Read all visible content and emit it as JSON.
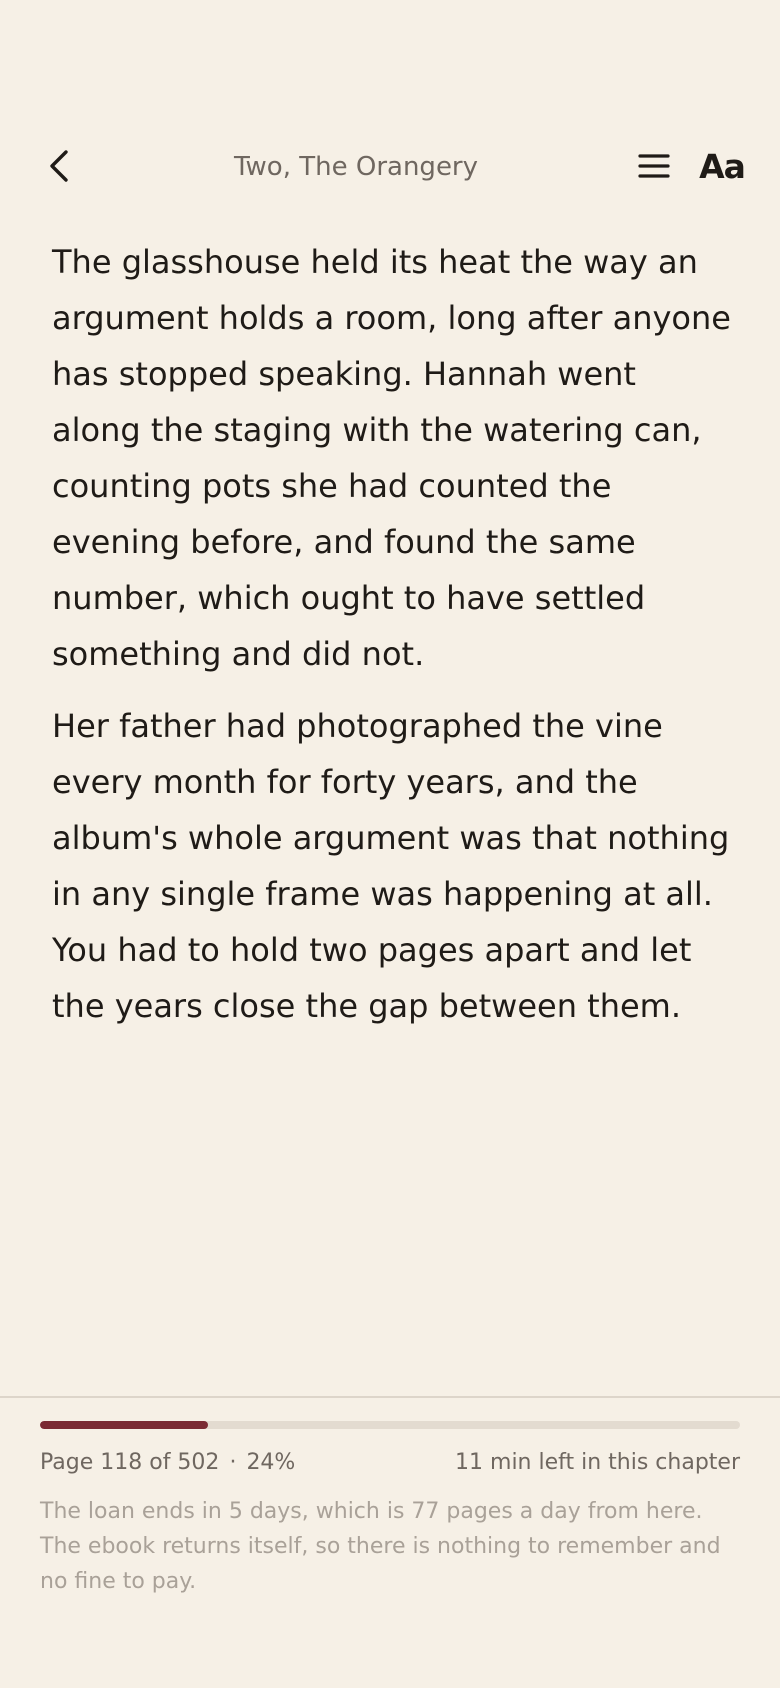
{
  "header": {
    "chapter_title": "Two, The Orangery",
    "back_icon": "chevron-left-icon",
    "menu_icon": "hamburger-menu-icon",
    "font_settings_label": "Aa"
  },
  "content": {
    "paragraphs": [
      "The glasshouse held its heat the way an argument holds a room, long after anyone has stopped speaking. Hannah went along the staging with the watering can, counting pots she had counted the evening before, and found the same number, which ought to have settled something and did not.",
      "Her father had photographed the vine every month for forty years, and the album's whole argument was that nothing in any single frame was happening at all. You had to hold two pages apart and let the years close the gap between them."
    ]
  },
  "footer": {
    "progress_percent": 24,
    "page_label": "Page 118 of 502",
    "separator": "·",
    "percent_label": "24%",
    "time_left": "11 min left in this chapter",
    "loan_note": "The loan ends in 5 days, which is 77 pages a day from here. The ebook returns itself, so there is nothing to remember and no fine to pay."
  },
  "colors": {
    "background": "#f6f0e6",
    "text": "#1f1b17",
    "muted_text": "#6f6760",
    "faint_text": "#a9a198",
    "accent": "#7a2a33",
    "track": "#e3dbd0"
  }
}
